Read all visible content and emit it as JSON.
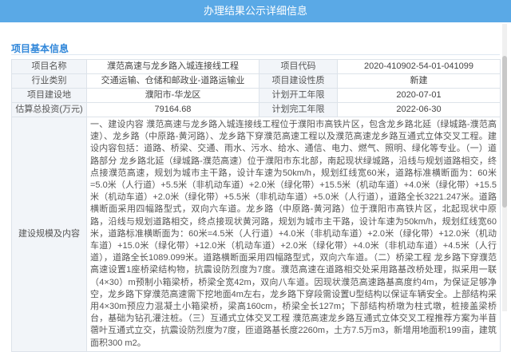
{
  "dialog": {
    "title": "办理结果公示详细信息"
  },
  "section": {
    "title": "项目基本信息"
  },
  "rows": [
    [
      {
        "label": "项目名称"
      },
      {
        "value": "濮范高速与龙乡路入城连接线工程"
      },
      {
        "label": "项目代码"
      },
      {
        "value": "2020-410902-54-01-041099"
      }
    ],
    [
      {
        "label": "行业类别"
      },
      {
        "value": "交通运输、仓储和邮政业-道路运输业"
      },
      {
        "label": "项目建设性质"
      },
      {
        "value": "新建"
      }
    ],
    [
      {
        "label": "项目建设地"
      },
      {
        "value": "濮阳市-华龙区"
      },
      {
        "label": "计划开工年限"
      },
      {
        "value": "2020-07-01"
      }
    ],
    [
      {
        "label": "估算总投资(万元)"
      },
      {
        "value": "79164.68"
      },
      {
        "label": "计划完工年限"
      },
      {
        "value": "2022-06-30"
      }
    ]
  ],
  "description": {
    "label": "建设规模及内容",
    "text": "一、建设内容 濮范高速与龙乡路入城连接线工程位于濮阳市高铁片区，包含龙乡路北延（绿城路-濮范高速）、龙乡路（中原路-黄河路）、龙乡路下穿濮范高速工程以及濮范高速龙乡路互通式立体交叉工程。建设内容包括：道路、桥梁、交通、雨水、污水、给水、通信、电力、燃气、照明、绿化等专业。（一）道路部分 龙乡路北延（绿城路-濮范高速）位于濮阳市东北部，南起现状绿城路，沿线与规划道路相交，终点接濮范高速，规划为城市主干路，设计车速为50km/h，规划红线宽60米，道路标准横断面为：60米=5.0米（人行道）+5.5米（非机动车道）+2.0米（绿化带）+15.5米（机动车道）+4.0米（绿化带）+15.5米（机动车道）+2.0米（绿化带）+5.5米（非机动车道）+5.0米（人行道），道路全长3221.247米。道路横断面采用四幅路型式，双向六车道。龙乡路（中原路-黄河路）位于濮阳市高铁片区，北起现状中原路，沿线与规划道路相交，终点接现状黄河路，规划为城市主干路，设计车速为50km/h，规划红线宽60米，道路标准横断面为：60米=4.5米（人行道）+4.0米（非机动车道）+2.0米（绿化带）+12.0米（机动车道）+15.0米（绿化带）+12.0米（机动车道）+2.0米（绿化带）+4.0米（非机动车道）+4.5米（人行道），道路全长1089.099米。道路横断面采用四幅路型式，双向六车道。（二）桥梁工程 龙乡路下穿濮范高速设置1座桥梁结构物，抗震设防烈度为7度。濮范高速在道路相交处采用路基改桥处理，拟采用一联（4×30）m预制小箱梁桥，桥梁全宽42m，双向八车道。因现状濮范高速路基高度约4m，为保证足够净空，龙乡路下穿濮范高速需下挖地面4m左右，龙乡路下穿段需设置U型结构以保证车辆安全。上部结构采用4×30m预应力混凝土小箱梁桥，梁高160cm，桥梁全长127m；下部结构桥墩为柱式墩，桩接盖梁桥台，基础为钻孔灌注桩。（三）互通式立体交叉工程 濮范高速龙乡路互通式立体交叉工程推荐方案为半苜蓿叶互通式立交，抗震设防烈度为7度，匝道路基长度2260m，土方7.5万m3，新增用地面积199亩，建筑面积300 m2。"
  },
  "colors": {
    "header": "#5aa9e6",
    "accent": "#2f86d9",
    "label_bg": "#f2f5f9",
    "border": "#dde3ea"
  }
}
